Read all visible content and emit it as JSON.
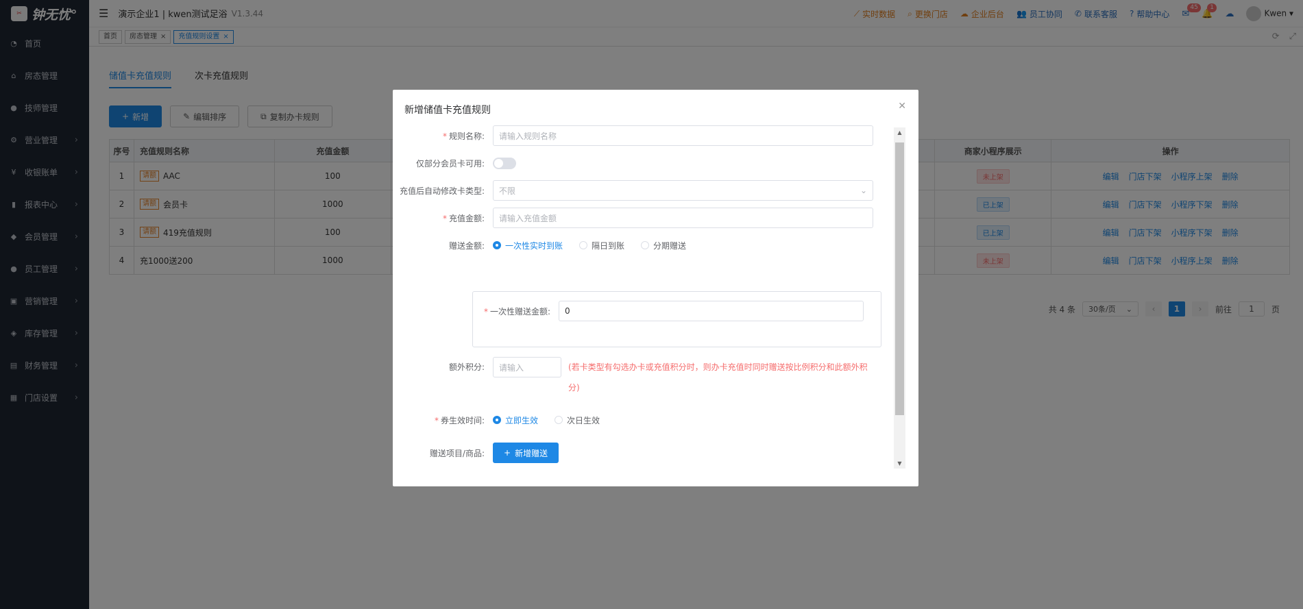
{
  "app": {
    "logo_badge": "钟无忧",
    "logo_text": "钟无忧°",
    "title": "演示企业1 | kwen测试足浴",
    "version": "V1.3.44"
  },
  "topnav": [
    {
      "label": "实时数据",
      "icon": "chart-icon",
      "color": "orange"
    },
    {
      "label": "更换门店",
      "icon": "search-icon",
      "color": "orange"
    },
    {
      "label": "企业后台",
      "icon": "cloud-icon",
      "color": "orange"
    },
    {
      "label": "员工协同",
      "icon": "users-icon",
      "color": "blue"
    },
    {
      "label": "联系客服",
      "icon": "phone-icon",
      "color": "blue"
    },
    {
      "label": "帮助中心",
      "icon": "help-icon",
      "color": "blue"
    }
  ],
  "notifications": {
    "mail_count": "45",
    "bell_count": "1"
  },
  "user": {
    "name": "Kwen"
  },
  "sidebar": [
    {
      "label": "首页",
      "icon": "dashboard-icon",
      "arrow": false
    },
    {
      "label": "房态管理",
      "icon": "home-icon",
      "arrow": false
    },
    {
      "label": "技师管理",
      "icon": "user-icon",
      "arrow": false
    },
    {
      "label": "营业管理",
      "icon": "settings-icon",
      "arrow": true
    },
    {
      "label": "收银账单",
      "icon": "money-icon",
      "arrow": true
    },
    {
      "label": "报表中心",
      "icon": "bar-chart-icon",
      "arrow": true
    },
    {
      "label": "会员管理",
      "icon": "diamond-icon",
      "arrow": true
    },
    {
      "label": "员工管理",
      "icon": "user-icon",
      "arrow": true
    },
    {
      "label": "营销管理",
      "icon": "gift-icon",
      "arrow": true
    },
    {
      "label": "库存管理",
      "icon": "box-icon",
      "arrow": true
    },
    {
      "label": "财务管理",
      "icon": "wallet-icon",
      "arrow": true
    },
    {
      "label": "门店设置",
      "icon": "grid-icon",
      "arrow": true
    }
  ],
  "tags": [
    {
      "label": "首页",
      "closable": false,
      "active": false
    },
    {
      "label": "房态管理",
      "closable": true,
      "active": false
    },
    {
      "label": "充值规则设置",
      "closable": true,
      "active": true
    }
  ],
  "tabs": [
    "储值卡充值规则",
    "次卡充值规则"
  ],
  "buttons": {
    "add": "新增",
    "sort": "编辑排序",
    "copy": "复制办卡规则"
  },
  "table": {
    "headers": [
      "序号",
      "充值规则名称",
      "充值金额",
      "商家小程序展示",
      "操作"
    ],
    "rows": [
      {
        "no": "1",
        "tag": "请额",
        "name": "AAC",
        "amount": "100",
        "status": "未上架",
        "status_type": "off",
        "ops": [
          "编辑",
          "门店下架",
          "小程序上架",
          "删除"
        ]
      },
      {
        "no": "2",
        "tag": "请额",
        "name": "会员卡",
        "amount": "1000",
        "status": "已上架",
        "status_type": "on",
        "ops": [
          "编辑",
          "门店下架",
          "小程序下架",
          "删除"
        ]
      },
      {
        "no": "3",
        "tag": "请额",
        "name": "419充值规则",
        "amount": "100",
        "status": "已上架",
        "status_type": "on",
        "ops": [
          "编辑",
          "门店下架",
          "小程序下架",
          "删除"
        ]
      },
      {
        "no": "4",
        "tag": "",
        "name": "充1000送200",
        "amount": "1000",
        "status": "未上架",
        "status_type": "off",
        "ops": [
          "编辑",
          "门店下架",
          "小程序上架",
          "删除"
        ]
      }
    ]
  },
  "pagination": {
    "total": "共 4 条",
    "page_size": "30条/页",
    "current": "1",
    "goto_label": "前往",
    "goto_value": "1",
    "page_unit": "页"
  },
  "dialog": {
    "title": "新增储值卡充值规则",
    "rule_name_label": "规则名称:",
    "rule_name_placeholder": "请输入规则名称",
    "member_only_label": "仅部分会员卡可用:",
    "change_type_label": "充值后自动修改卡类型:",
    "change_type_value": "不限",
    "amount_label": "充值金额:",
    "amount_placeholder": "请输入充值金额",
    "gift_label": "赠送金额:",
    "gift_options": [
      "一次性实时到账",
      "隔日到账",
      "分期赠送"
    ],
    "once_label": "一次性赠送金额:",
    "once_value": "0",
    "points_label": "额外积分:",
    "points_placeholder": "请输入",
    "points_hint": "(若卡类型有勾选办卡或充值积分时，则办卡充值时同时赠送按比例积分和此额外积分)",
    "effect_label": "券生效时间:",
    "effect_options": [
      "立即生效",
      "次日生效"
    ],
    "gift_items_label": "赠送项目/商品:",
    "add_gift": "新增赠送"
  }
}
